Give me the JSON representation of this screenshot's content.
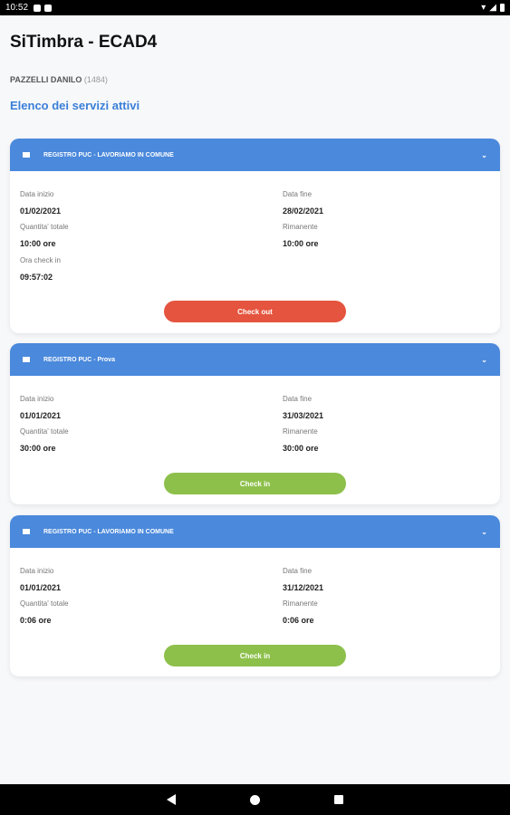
{
  "statusbar": {
    "time": "10:52"
  },
  "app": {
    "title": "SiTimbra - ECAD4"
  },
  "user": {
    "name": "PAZZELLI DANILO",
    "code": "(1484)"
  },
  "section_title": "Elenco dei servizi attivi",
  "cards": [
    {
      "title": "REGISTRO PUC - LAVORIAMO IN COMUNE",
      "start_label": "Data inizio",
      "start_value": "01/02/2021",
      "end_label": "Data fine",
      "end_value": "28/02/2021",
      "qty_label": "Quantita' totale",
      "qty_value": "10:00 ore",
      "rem_label": "Rimanente",
      "rem_value": "10:00 ore",
      "checkin_label": "Ora check in",
      "checkin_value": "09:57:02",
      "button": "Check out"
    },
    {
      "title": "REGISTRO PUC - Prova",
      "start_label": "Data inizio",
      "start_value": "01/01/2021",
      "end_label": "Data fine",
      "end_value": "31/03/2021",
      "qty_label": "Quantita' totale",
      "qty_value": "30:00 ore",
      "rem_label": "Rimanente",
      "rem_value": "30:00 ore",
      "button": "Check in"
    },
    {
      "title": "REGISTRO PUC - LAVORIAMO IN COMUNE",
      "start_label": "Data inizio",
      "start_value": "01/01/2021",
      "end_label": "Data fine",
      "end_value": "31/12/2021",
      "qty_label": "Quantita' totale",
      "qty_value": "0:06 ore",
      "rem_label": "Rimanente",
      "rem_value": "0:06 ore",
      "button": "Check in"
    }
  ],
  "colors": {
    "header_blue": "#4a89dc",
    "checkout_red": "#e5543e",
    "checkin_green": "#8dc04b",
    "link_blue": "#3a7fd8"
  },
  "icons": [
    "menu-icon",
    "chevron-down-icon",
    "wifi-icon",
    "battery-icon",
    "back-icon",
    "home-icon",
    "recents-icon"
  ]
}
